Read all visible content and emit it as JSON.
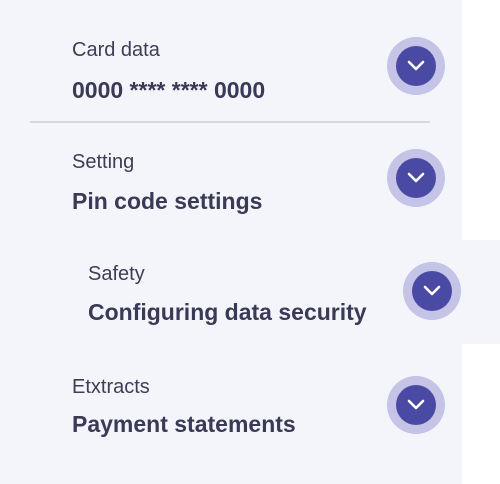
{
  "items": [
    {
      "label": "Card data",
      "value": "0000 **** **** 0000",
      "icon": "chevron-down-icon"
    },
    {
      "label": "Setting",
      "value": "Pin code settings",
      "icon": "chevron-down-icon"
    },
    {
      "label": "Safety",
      "value": "Configuring data security",
      "icon": "chevron-down-icon"
    },
    {
      "label": "Etxtracts",
      "value": "Payment statements",
      "icon": "chevron-down-icon"
    }
  ],
  "colors": {
    "background": "#f4f4fb",
    "text": "#3a3a56",
    "toggle_outer": "#c5c3e6",
    "toggle_inner": "#4a4aa4",
    "divider": "#d6d6e2"
  }
}
